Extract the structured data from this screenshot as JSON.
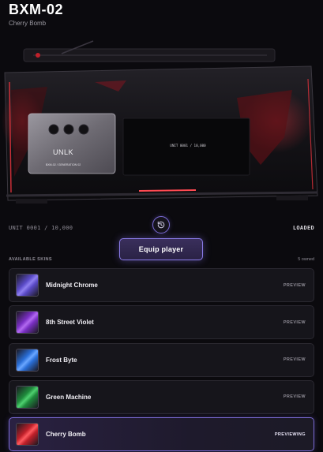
{
  "header": {
    "title": "BXM-02",
    "subtitle": "Cherry Bomb"
  },
  "device": {
    "brand": "UNLK",
    "plate_caption": "BXM-02 / GENERATION 02",
    "screen_text": "UNIT 0001 / 10,000"
  },
  "meta": {
    "unit_label": "UNIT 0001 / 10,000",
    "status": "LOADED"
  },
  "controls": {
    "rotate_icon": "rotate-ccw-icon",
    "equip_label": "Equip player"
  },
  "skins": {
    "heading": "AVAILABLE SKINS",
    "owned": "5 owned",
    "items": [
      {
        "name": "Midnight Chrome",
        "status": "PREVIEW",
        "color": "#5b4bc8",
        "accent": "#8f80f0"
      },
      {
        "name": "8th Street Violet",
        "status": "PREVIEW",
        "color": "#7a2fc4",
        "accent": "#b26af0"
      },
      {
        "name": "Frost Byte",
        "status": "PREVIEW",
        "color": "#2a6fd8",
        "accent": "#6aa6ff"
      },
      {
        "name": "Green Machine",
        "status": "PREVIEW",
        "color": "#1f8a3c",
        "accent": "#4fd070"
      },
      {
        "name": "Cherry Bomb",
        "status": "PREVIEWING",
        "color": "#c0202a",
        "accent": "#ff5a5f"
      }
    ]
  },
  "colors": {
    "accent": "#8a7be8",
    "background": "#0b0a0e",
    "cherry": "#e0323c"
  }
}
